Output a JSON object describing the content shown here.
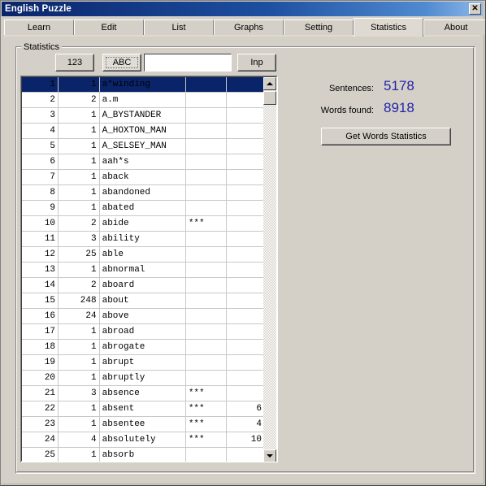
{
  "window": {
    "title": "English Puzzle",
    "close_label": "✕"
  },
  "tabs": [
    {
      "label": "Learn",
      "active": false
    },
    {
      "label": "Edit",
      "active": false
    },
    {
      "label": "List",
      "active": false
    },
    {
      "label": "Graphs",
      "active": false
    },
    {
      "label": "Setting",
      "active": false
    },
    {
      "label": "Statistics",
      "active": true
    },
    {
      "label": "About",
      "active": false
    }
  ],
  "groupbox": {
    "caption": "Statistics"
  },
  "toolbar": {
    "sort_numeric_label": "123",
    "sort_alpha_label": "ABC",
    "input_button_label": "Inp",
    "filter_value": "",
    "filter_placeholder": ""
  },
  "stats_panel": {
    "sentences_label": "Sentences:",
    "sentences_value": "5178",
    "words_found_label": "Words found:",
    "words_found_value": "8918",
    "get_stats_button_label": "Get Words Statistics",
    "value_color": "#2424a8"
  },
  "scrollbar": {
    "up_arrow": "up-arrow-icon",
    "down_arrow": "down-arrow-icon"
  },
  "grid": {
    "columns": [
      "index",
      "count",
      "word",
      "marker",
      "number"
    ],
    "rows": [
      {
        "index": "1",
        "count": "1",
        "word": "a*winding",
        "marker": "",
        "number": "",
        "selected": true
      },
      {
        "index": "2",
        "count": "2",
        "word": "a.m",
        "marker": "",
        "number": "",
        "selected": false
      },
      {
        "index": "3",
        "count": "1",
        "word": "A_BYSTANDER",
        "marker": "",
        "number": "",
        "selected": false
      },
      {
        "index": "4",
        "count": "1",
        "word": "A_HOXTON_MAN",
        "marker": "",
        "number": "",
        "selected": false
      },
      {
        "index": "5",
        "count": "1",
        "word": "A_SELSEY_MAN",
        "marker": "",
        "number": "",
        "selected": false
      },
      {
        "index": "6",
        "count": "1",
        "word": "aah*s",
        "marker": "",
        "number": "",
        "selected": false
      },
      {
        "index": "7",
        "count": "1",
        "word": "aback",
        "marker": "",
        "number": "",
        "selected": false
      },
      {
        "index": "8",
        "count": "1",
        "word": "abandoned",
        "marker": "",
        "number": "",
        "selected": false
      },
      {
        "index": "9",
        "count": "1",
        "word": "abated",
        "marker": "",
        "number": "",
        "selected": false
      },
      {
        "index": "10",
        "count": "2",
        "word": "abide",
        "marker": "***",
        "number": "",
        "selected": false
      },
      {
        "index": "11",
        "count": "3",
        "word": "ability",
        "marker": "",
        "number": "",
        "selected": false
      },
      {
        "index": "12",
        "count": "25",
        "word": "able",
        "marker": "",
        "number": "",
        "selected": false
      },
      {
        "index": "13",
        "count": "1",
        "word": "abnormal",
        "marker": "",
        "number": "",
        "selected": false
      },
      {
        "index": "14",
        "count": "2",
        "word": "aboard",
        "marker": "",
        "number": "",
        "selected": false
      },
      {
        "index": "15",
        "count": "248",
        "word": "about",
        "marker": "",
        "number": "",
        "selected": false
      },
      {
        "index": "16",
        "count": "24",
        "word": "above",
        "marker": "",
        "number": "",
        "selected": false
      },
      {
        "index": "17",
        "count": "1",
        "word": "abroad",
        "marker": "",
        "number": "",
        "selected": false
      },
      {
        "index": "18",
        "count": "1",
        "word": "abrogate",
        "marker": "",
        "number": "",
        "selected": false
      },
      {
        "index": "19",
        "count": "1",
        "word": "abrupt",
        "marker": "",
        "number": "",
        "selected": false
      },
      {
        "index": "20",
        "count": "1",
        "word": "abruptly",
        "marker": "",
        "number": "",
        "selected": false
      },
      {
        "index": "21",
        "count": "3",
        "word": "absence",
        "marker": "***",
        "number": "",
        "selected": false
      },
      {
        "index": "22",
        "count": "1",
        "word": "absent",
        "marker": "***",
        "number": "6",
        "selected": false
      },
      {
        "index": "23",
        "count": "1",
        "word": "absentee",
        "marker": "***",
        "number": "4",
        "selected": false
      },
      {
        "index": "24",
        "count": "4",
        "word": "absolutely",
        "marker": "***",
        "number": "10",
        "selected": false
      },
      {
        "index": "25",
        "count": "1",
        "word": "absorb",
        "marker": "",
        "number": "",
        "selected": false
      }
    ]
  }
}
